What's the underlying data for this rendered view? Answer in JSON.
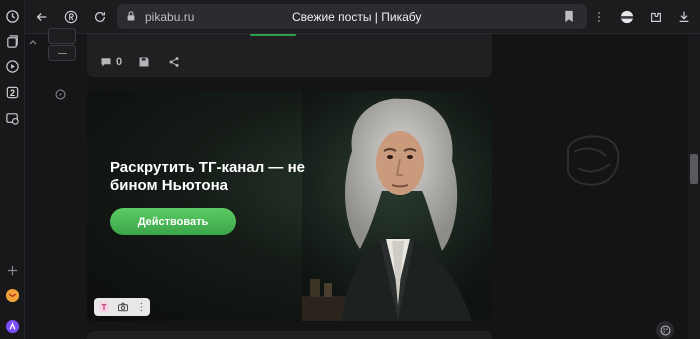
{
  "browser": {
    "domain": "pikabu.ru",
    "tab_title": "Свежие посты | Пикабу"
  },
  "post": {
    "comments_count": "0"
  },
  "ad": {
    "title": "Раскрутить ТГ-канал — не бином Ньютона",
    "button_label": "Действовать",
    "tools_menu": "⋮"
  },
  "sidebar_tab_number": "2",
  "colors": {
    "accent_green": "#3ba54a",
    "background": "#141414",
    "card": "#202023"
  }
}
